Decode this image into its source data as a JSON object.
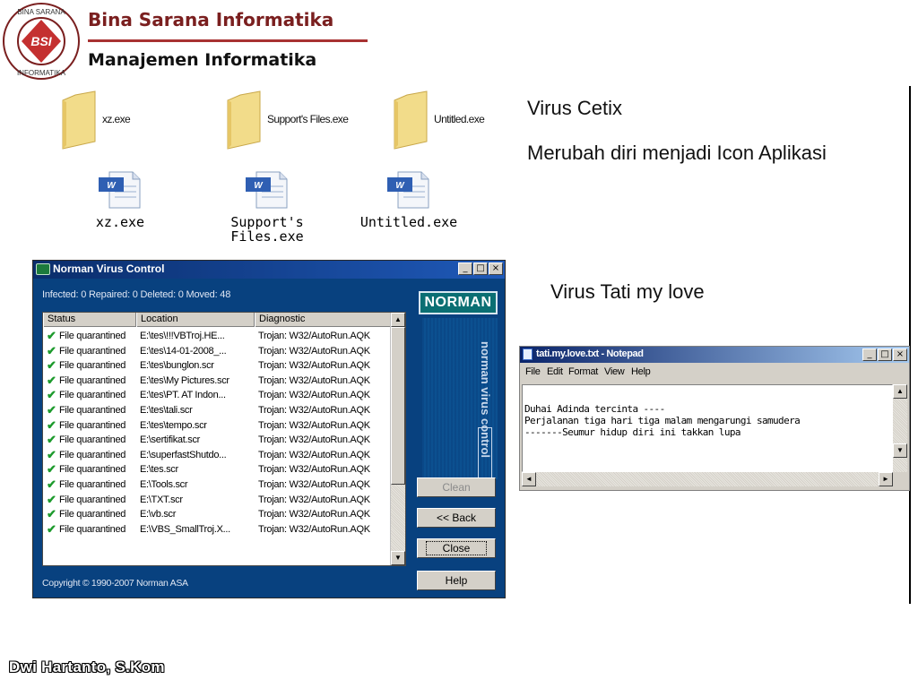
{
  "header": {
    "org_name": "Bina Sarana Informatika",
    "org_sub": "Manajemen Informatika",
    "logo_text": "BINA SARANA INFORMATIKA",
    "logo_mark": "BSI"
  },
  "folders": [
    {
      "label": "xz.exe"
    },
    {
      "label": "Support's Files.exe"
    },
    {
      "label": "Untitled.exe"
    }
  ],
  "docs": [
    {
      "label": "xz.exe"
    },
    {
      "label": "Support's\nFiles.exe"
    },
    {
      "label": "Untitled.exe"
    }
  ],
  "virus1": {
    "title": "Virus Cetix",
    "desc": "Merubah diri menjadi Icon Aplikasi"
  },
  "virus2": {
    "title": "Virus Tati my love"
  },
  "norman": {
    "title": "Norman Virus Control",
    "stats": "Infected: 0   Repaired: 0   Deleted: 0   Moved: 48",
    "brand": "NORMAN",
    "vertical_text": "norman virus control",
    "columns": [
      "Status",
      "Location",
      "Diagnostic"
    ],
    "rows": [
      {
        "status": "File quarantined",
        "location": "E:\\tes\\!!!VBTroj.HE...",
        "diagnostic": "Trojan: W32/AutoRun.AQK"
      },
      {
        "status": "File quarantined",
        "location": "E:\\tes\\14-01-2008_...",
        "diagnostic": "Trojan: W32/AutoRun.AQK"
      },
      {
        "status": "File quarantined",
        "location": "E:\\tes\\bunglon.scr",
        "diagnostic": "Trojan: W32/AutoRun.AQK"
      },
      {
        "status": "File quarantined",
        "location": "E:\\tes\\My Pictures.scr",
        "diagnostic": "Trojan: W32/AutoRun.AQK"
      },
      {
        "status": "File quarantined",
        "location": "E:\\tes\\PT. AT Indon...",
        "diagnostic": "Trojan: W32/AutoRun.AQK"
      },
      {
        "status": "File quarantined",
        "location": "E:\\tes\\tali.scr",
        "diagnostic": "Trojan: W32/AutoRun.AQK"
      },
      {
        "status": "File quarantined",
        "location": "E:\\tes\\tempo.scr",
        "diagnostic": "Trojan: W32/AutoRun.AQK"
      },
      {
        "status": "File quarantined",
        "location": "E:\\sertifikat.scr",
        "diagnostic": "Trojan: W32/AutoRun.AQK"
      },
      {
        "status": "File quarantined",
        "location": "E:\\superfastShutdo...",
        "diagnostic": "Trojan: W32/AutoRun.AQK"
      },
      {
        "status": "File quarantined",
        "location": "E:\\tes.scr",
        "diagnostic": "Trojan: W32/AutoRun.AQK"
      },
      {
        "status": "File quarantined",
        "location": "E:\\Tools.scr",
        "diagnostic": "Trojan: W32/AutoRun.AQK"
      },
      {
        "status": "File quarantined",
        "location": "E:\\TXT.scr",
        "diagnostic": "Trojan: W32/AutoRun.AQK"
      },
      {
        "status": "File quarantined",
        "location": "E:\\vb.scr",
        "diagnostic": "Trojan: W32/AutoRun.AQK"
      },
      {
        "status": "File quarantined",
        "location": "E:\\VBS_SmallTroj.X...",
        "diagnostic": "Trojan: W32/AutoRun.AQK"
      }
    ],
    "buttons": {
      "clean": "Clean",
      "back": "<< Back",
      "close": "Close",
      "help": "Help"
    },
    "copyright": "Copyright © 1990-2007 Norman ASA"
  },
  "notepad": {
    "title": "tati.my.love.txt - Notepad",
    "menu": [
      "File",
      "Edit",
      "Format",
      "View",
      "Help"
    ],
    "content": "Duhai Adinda tercinta ----\nPerjalanan tiga hari tiga malam mengarungi samudera\n-------Seumur hidup diri ini takkan lupa"
  },
  "footer": {
    "author": "Dwi Hartanto, S.Kom"
  },
  "colors": {
    "org_name": "#7a1f1f",
    "norman_bg": "#08417f",
    "check": "#1c9a2c"
  }
}
